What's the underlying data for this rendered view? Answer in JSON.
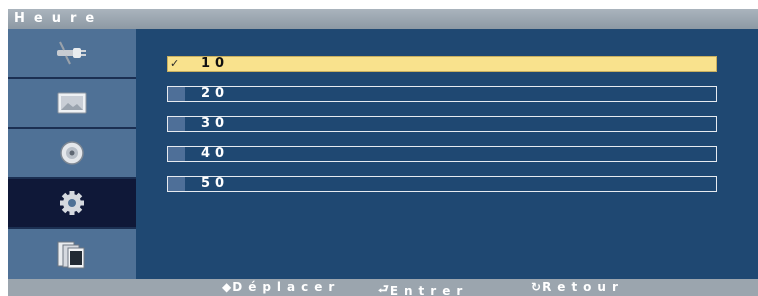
{
  "window": {
    "title": "Heure"
  },
  "sidebar": {
    "items": [
      {
        "icon": "input-plug-icon",
        "active": false
      },
      {
        "icon": "picture-icon",
        "active": false
      },
      {
        "icon": "sound-speaker-icon",
        "active": false
      },
      {
        "icon": "setup-gear-icon",
        "active": true
      },
      {
        "icon": "multi-window-icon",
        "active": false
      }
    ]
  },
  "options": [
    {
      "label": "10",
      "selected": true,
      "check": "✓"
    },
    {
      "label": "20",
      "selected": false
    },
    {
      "label": "30",
      "selected": false
    },
    {
      "label": "40",
      "selected": false
    },
    {
      "label": "50",
      "selected": false
    }
  ],
  "footer": {
    "move": {
      "icon": "updown-arrows-icon",
      "glyph": "◆",
      "label": "Déplacer"
    },
    "enter": {
      "icon": "enter-icon",
      "glyph": "⮐",
      "label": "Entrer"
    },
    "back": {
      "icon": "return-icon",
      "glyph": "↻",
      "label": "Retour"
    }
  },
  "colors": {
    "panel": "#1f4872",
    "sidebar_item": "#4f7196",
    "sidebar_active": "#0f1838",
    "selected_option": "#f9e28d",
    "titlebar": "#9ba5ae"
  }
}
